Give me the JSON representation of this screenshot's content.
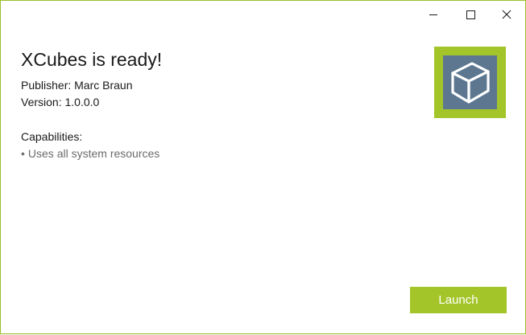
{
  "window": {
    "controls": {
      "minimize_icon": "minimize-icon",
      "maximize_icon": "maximize-icon",
      "close_icon": "close-icon"
    }
  },
  "app": {
    "title": "XCubes is ready!",
    "publisher": "Publisher: Marc Braun",
    "version": "Version: 1.0.0.0",
    "capabilities_heading": "Capabilities:",
    "capabilities": [
      {
        "bullet": "•",
        "text": "Uses all system resources"
      }
    ],
    "icon": "cube-icon"
  },
  "actions": {
    "launch_label": "Launch"
  },
  "colors": {
    "accent": "#a4c52a",
    "tile_inner": "#5d7791",
    "window_border": "#9bbf2a",
    "text_primary": "#1a1a1a",
    "text_secondary": "#6b6b6b"
  }
}
